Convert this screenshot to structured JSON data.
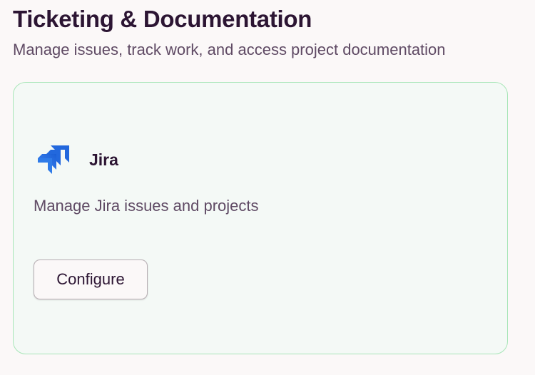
{
  "section": {
    "title": "Ticketing & Documentation",
    "subtitle": "Manage issues, track work, and access project documentation"
  },
  "integrations": [
    {
      "name": "Jira",
      "icon": "jira-logo",
      "description": "Manage Jira issues and projects",
      "action_label": "Configure"
    }
  ],
  "colors": {
    "card_border": "#a8e6b8",
    "card_background": "#f4f9f6",
    "jira_blue": "#2268dd",
    "heading_text": "#2c1533",
    "body_text": "#5f4a64"
  }
}
